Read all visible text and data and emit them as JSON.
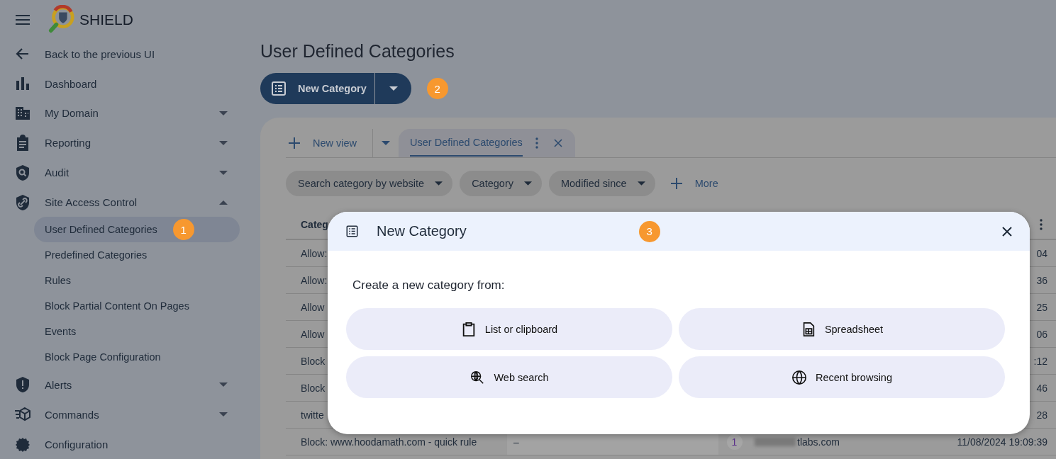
{
  "app": {
    "name": "SHIELD"
  },
  "sidebar": {
    "items": [
      {
        "label": "Back to the previous UI",
        "selected": false
      },
      {
        "label": "Dashboard",
        "selected": false
      },
      {
        "label": "My Domain",
        "selected": false,
        "expanded": false
      },
      {
        "label": "Reporting",
        "selected": false,
        "expanded": false
      },
      {
        "label": "Audit",
        "selected": false,
        "expanded": false
      },
      {
        "label": "Site Access Control",
        "selected": false,
        "expanded": true,
        "children": [
          {
            "label": "User Defined Categories",
            "selected": true,
            "badge": "1"
          },
          {
            "label": "Predefined Categories",
            "selected": false
          },
          {
            "label": "Rules",
            "selected": false
          },
          {
            "label": "Block Partial Content On Pages",
            "selected": false
          },
          {
            "label": "Events",
            "selected": false
          },
          {
            "label": "Block Page Configuration",
            "selected": false
          }
        ]
      },
      {
        "label": "Alerts",
        "selected": false,
        "expanded": false
      },
      {
        "label": "Commands",
        "selected": false,
        "expanded": false
      },
      {
        "label": "Configuration",
        "selected": false
      }
    ]
  },
  "page_title": "User Defined Categories",
  "new_category_button": {
    "label": "New Category",
    "badge": "2"
  },
  "view_tabs": {
    "new_view": "New view",
    "tabs": [
      {
        "label": "User Defined Categories",
        "selected": true
      }
    ]
  },
  "filters": [
    {
      "label": "Search category by website"
    },
    {
      "label": "Category"
    },
    {
      "label": "Modified since"
    }
  ],
  "more_filters": "More",
  "table": {
    "columns": [
      "Categ"
    ],
    "rows": [
      {
        "column_1": "Allow:",
        "column_5": "04"
      },
      {
        "column_1": "Allow:",
        "column_5": "36"
      },
      {
        "column_1": "Allow",
        "column_5": "25"
      },
      {
        "column_1": "Allow",
        "column_5": "06"
      },
      {
        "column_1": "Block",
        "column_5": ":12"
      },
      {
        "column_1": "Block",
        "column_5": "46"
      },
      {
        "column_1": "twitte",
        "column_5": "28"
      },
      {
        "column_1": "Block: www.hoodamath.com - quick rule",
        "column_2": "–",
        "column_3": "1",
        "column_4": "tlabs.com",
        "column_5": "11/08/2024 19:09:39"
      }
    ]
  },
  "dialog": {
    "title": "New Category",
    "badge": "3",
    "prompt": "Create a new category from:",
    "options": [
      {
        "label": "List or clipboard"
      },
      {
        "label": "Spreadsheet"
      },
      {
        "label": "Web search"
      },
      {
        "label": "Recent browsing"
      }
    ]
  }
}
